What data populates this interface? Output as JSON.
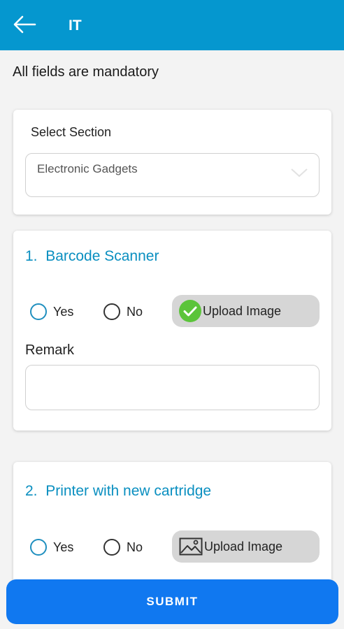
{
  "appbar": {
    "title": "IT",
    "back_icon": "arrow-left-icon"
  },
  "notice": "All fields are mandatory",
  "section_card": {
    "label": "Select Section",
    "selected": "Electronic Gadgets"
  },
  "questions": [
    {
      "number": "1.",
      "title": "Barcode Scanner",
      "yes_label": "Yes",
      "no_label": "No",
      "upload_label": "Upload Image",
      "upload_icon": "check-circle-icon",
      "remark_label": "Remark",
      "remark_value": ""
    },
    {
      "number": "2.",
      "title": "Printer with new cartridge",
      "yes_label": "Yes",
      "no_label": "No",
      "upload_label": "Upload Image",
      "upload_icon": "image-icon"
    }
  ],
  "submit_label": "SUBMIT",
  "colors": {
    "appbar": "#0597cf",
    "question_title": "#0a8fc0",
    "upload_check": "#5bc43a",
    "submit": "#1078f0"
  }
}
